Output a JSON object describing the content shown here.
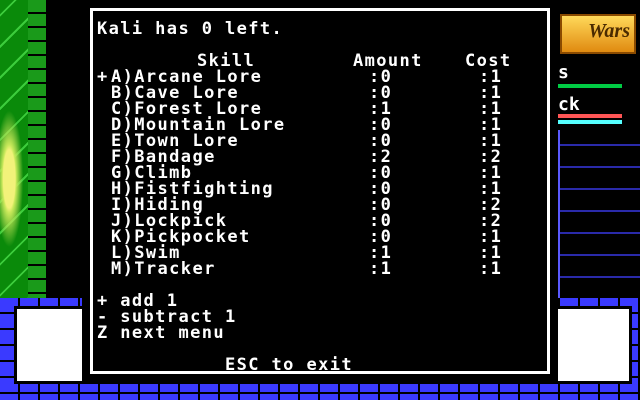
{
  "header": {
    "status_text": "Kali has 0 left."
  },
  "columns": {
    "skill": "Skill",
    "amount": "Amount",
    "cost": "Cost"
  },
  "skills": [
    {
      "marker": "+",
      "label": "A)Arcane Lore",
      "amount": ":0",
      "cost": ":1"
    },
    {
      "marker": "",
      "label": "B)Cave Lore",
      "amount": ":0",
      "cost": ":1"
    },
    {
      "marker": "",
      "label": "C)Forest Lore",
      "amount": ":1",
      "cost": ":1"
    },
    {
      "marker": "",
      "label": "D)Mountain Lore",
      "amount": ":0",
      "cost": ":1"
    },
    {
      "marker": "",
      "label": "E)Town Lore",
      "amount": ":0",
      "cost": ":1"
    },
    {
      "marker": "",
      "label": "F)Bandage",
      "amount": ":2",
      "cost": ":2"
    },
    {
      "marker": "",
      "label": "G)Climb",
      "amount": ":0",
      "cost": ":1"
    },
    {
      "marker": "",
      "label": "H)Fistfighting",
      "amount": ":0",
      "cost": ":1"
    },
    {
      "marker": "",
      "label": "I)Hiding",
      "amount": ":0",
      "cost": ":2"
    },
    {
      "marker": "",
      "label": "J)Lockpick",
      "amount": ":0",
      "cost": ":2"
    },
    {
      "marker": "",
      "label": "K)Pickpocket",
      "amount": ":0",
      "cost": ":1"
    },
    {
      "marker": "",
      "label": "L)Swim",
      "amount": ":1",
      "cost": ":1"
    },
    {
      "marker": "",
      "label": "M)Tracker",
      "amount": ":1",
      "cost": ":1"
    }
  ],
  "help": {
    "add": "+ add 1",
    "subtract": "- subtract 1",
    "next": "Z next menu"
  },
  "footer": {
    "exit": "ESC to exit"
  },
  "side": {
    "logo_text": "Wars",
    "text1": "s",
    "text2": "ck"
  },
  "colors": {
    "text": "#ffffff",
    "background": "#000000",
    "bar_green": "#00cc44",
    "bar_red": "#ff5555",
    "bar_teal": "#55ffff",
    "border_blue": "#3a3aff"
  }
}
